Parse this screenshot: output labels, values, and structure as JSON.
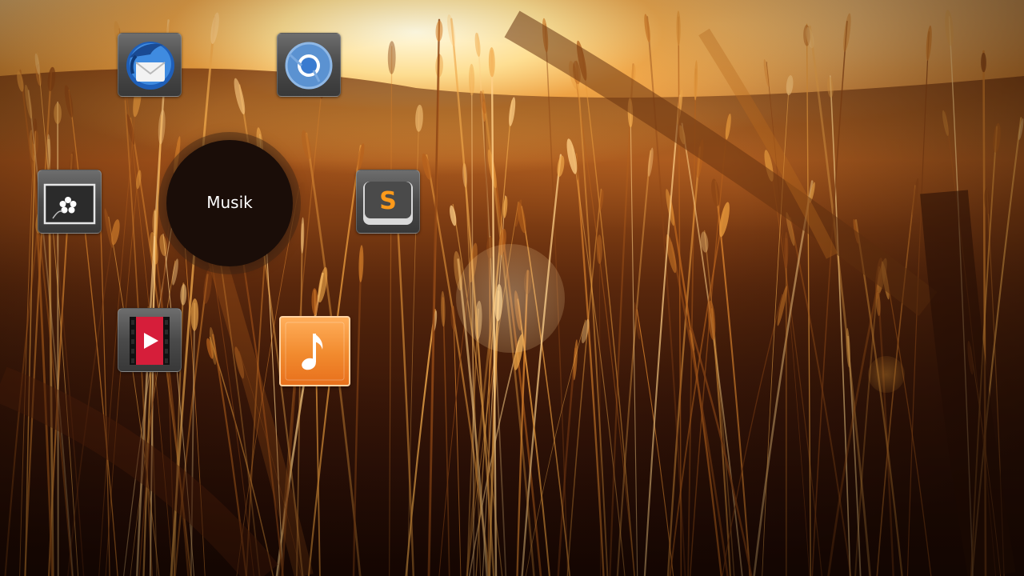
{
  "desktop": {
    "wallpaper": "golden-wheat-field-sunset",
    "accent_colors": {
      "sun": "#fff6dc",
      "amber": "#d68a34",
      "shadow": "#230d05"
    }
  },
  "icons": [
    {
      "id": "thunderbird",
      "icon": "thunderbird-mail-icon"
    },
    {
      "id": "chromium",
      "icon": "chromium-browser-icon"
    },
    {
      "id": "photos",
      "icon": "photo-viewer-icon"
    },
    {
      "id": "sublime",
      "icon": "sublime-text-icon"
    },
    {
      "id": "video",
      "icon": "video-player-icon"
    },
    {
      "id": "music",
      "icon": "music-player-icon"
    }
  ],
  "tooltip": {
    "label": "Musik"
  }
}
